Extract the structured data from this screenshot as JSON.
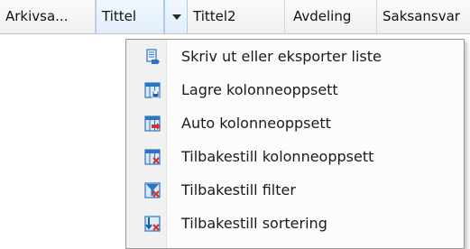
{
  "columns": [
    {
      "label": "Arkivsa..."
    },
    {
      "label": "Tittel"
    },
    {
      "label": "Tittel2"
    },
    {
      "label": "Avdeling"
    },
    {
      "label": "Saksansvar"
    }
  ],
  "menu": {
    "items": [
      {
        "label": "Skriv ut eller eksporter liste",
        "icon": "print-export-icon"
      },
      {
        "label": "Lagre kolonneoppsett",
        "icon": "save-columns-icon"
      },
      {
        "label": "Auto kolonneoppsett",
        "icon": "auto-columns-icon"
      },
      {
        "label": "Tilbakestill kolonneoppsett",
        "icon": "reset-columns-icon"
      },
      {
        "label": "Tilbakestill filter",
        "icon": "reset-filter-icon"
      },
      {
        "label": "Tilbakestill sortering",
        "icon": "reset-sort-icon"
      }
    ]
  },
  "colors": {
    "header_bg": "#f0f0f0",
    "active_header": "#e1eefb",
    "menu_bg": "#fcfcfc",
    "menu_gutter": "#f1f1f1",
    "icon_blue": "#2f74c0",
    "icon_red": "#d0342c"
  }
}
